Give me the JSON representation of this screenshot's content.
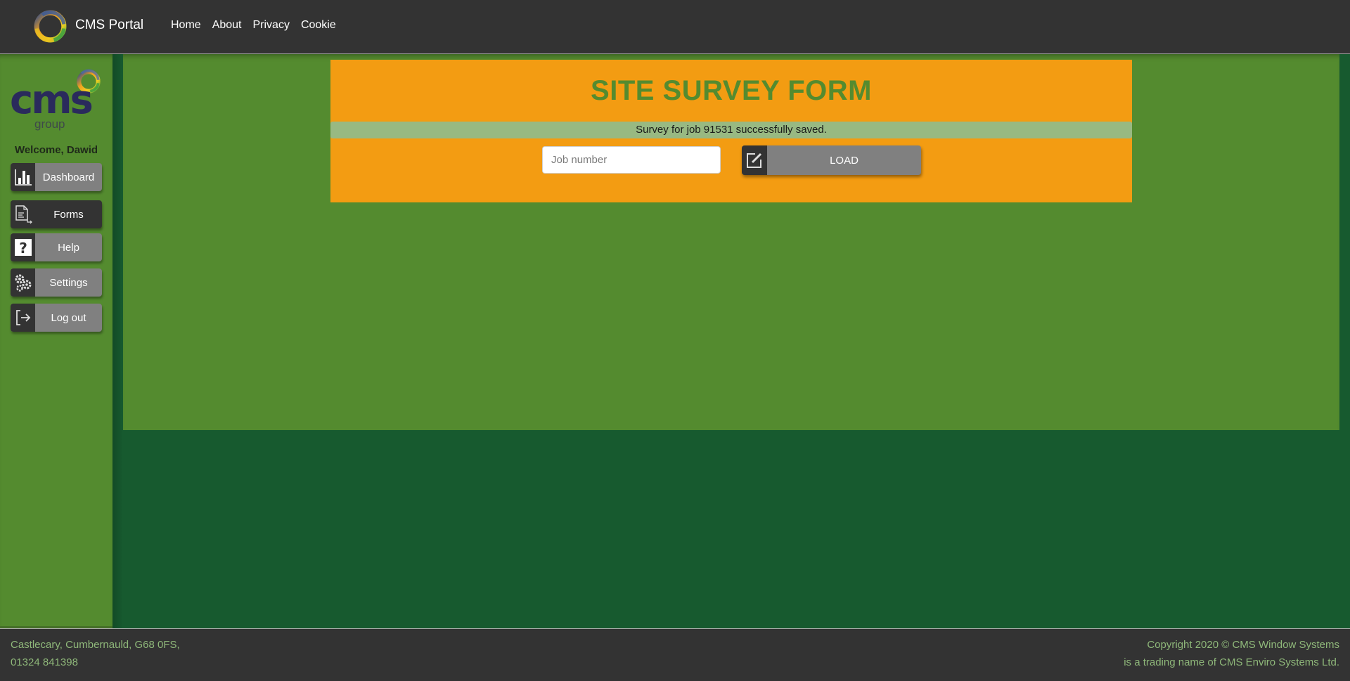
{
  "header": {
    "brand_name": "CMS Portal",
    "brand_icon": "cms-ring-logo-icon",
    "nav": [
      {
        "label": "Home"
      },
      {
        "label": "About"
      },
      {
        "label": "Privacy"
      },
      {
        "label": "Cookie"
      }
    ]
  },
  "sidebar": {
    "logo_text": "cms",
    "logo_subtext": "group",
    "welcome": "Welcome, Dawid",
    "items": [
      {
        "label": "Dashboard",
        "icon": "bar-chart-icon",
        "active": false
      },
      {
        "label": "Forms",
        "icon": "document-icon",
        "active": true
      },
      {
        "label": "Help",
        "icon": "question-icon",
        "active": false
      },
      {
        "label": "Settings",
        "icon": "gears-icon",
        "active": false
      },
      {
        "label": "Log out",
        "icon": "logout-icon",
        "active": false
      }
    ]
  },
  "main": {
    "title": "SITE SURVEY FORM",
    "alert": "Survey for job 91531 successfully saved.",
    "job_input": {
      "placeholder": "Job number",
      "value": ""
    },
    "load_button": {
      "label": "LOAD",
      "icon": "edit-icon"
    }
  },
  "footer": {
    "address_line1": "Castlecary, Cumbernauld, G68 0FS,",
    "address_line2": "01324 841398",
    "copyright_line1": "Copyright 2020 © CMS Window Systems",
    "copyright_line2": "is a trading name of CMS Enviro Systems Ltd."
  },
  "colors": {
    "header_bg": "#333333",
    "sidebar_bg": "#548b2f",
    "page_bg": "#175a2f",
    "panel_bg": "#f39c12",
    "title_color": "#548b2f",
    "alert_bg": "#98b982",
    "button_gray": "#808080",
    "footer_text": "#8fb87a"
  }
}
